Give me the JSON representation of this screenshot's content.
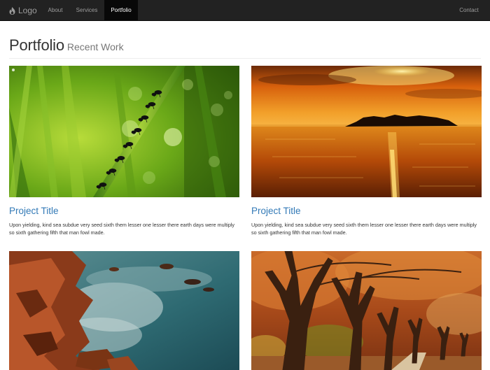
{
  "nav": {
    "logo_label": "Logo",
    "logo_icon": "flame-icon",
    "items": [
      {
        "label": "About",
        "active": false
      },
      {
        "label": "Services",
        "active": false
      },
      {
        "label": "Portfolio",
        "active": true
      }
    ],
    "right_item": {
      "label": "Contact"
    }
  },
  "header": {
    "title": "Portfolio",
    "subtitle": "Recent Work"
  },
  "items": [
    {
      "title": "Project Title",
      "text": "Upon yielding, kind sea subdue very seed sixth them lesser one lesser there earth days were multiply so sixth gathering fifth that man fowl made."
    },
    {
      "title": "Project Title",
      "text": "Upon yielding, kind sea subdue very seed sixth them lesser one lesser there earth days were multiply so sixth gathering fifth that man fowl made."
    }
  ],
  "colors": {
    "navbar_bg": "#222222",
    "link": "#337ab7"
  }
}
